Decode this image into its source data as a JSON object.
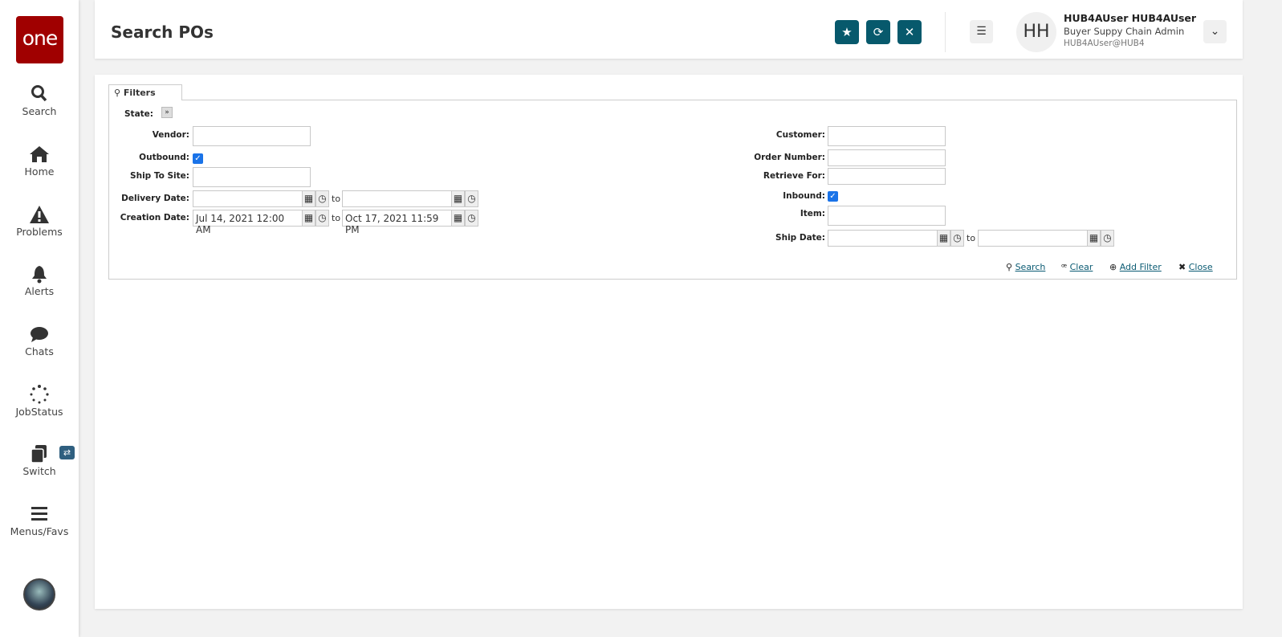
{
  "sidebar": {
    "logo": "one",
    "items": [
      {
        "label": "Search",
        "icon": "search-icon"
      },
      {
        "label": "Home",
        "icon": "home-icon"
      },
      {
        "label": "Problems",
        "icon": "warning-icon"
      },
      {
        "label": "Alerts",
        "icon": "bell-icon"
      },
      {
        "label": "Chats",
        "icon": "chat-icon"
      },
      {
        "label": "JobStatus",
        "icon": "spinner-icon"
      },
      {
        "label": "Switch",
        "icon": "switch-icon"
      },
      {
        "label": "Menus/Favs",
        "icon": "menu-icon"
      }
    ],
    "switch_badge": "⇄"
  },
  "header": {
    "title": "Search POs",
    "user": {
      "initials": "HH",
      "name": "HUB4AUser HUB4AUser",
      "role": "Buyer Suppy Chain Admin",
      "login": "HUB4AUser@HUB4"
    }
  },
  "filters": {
    "tab": "Filters",
    "left": {
      "state": "State:",
      "vendor": "Vendor:",
      "outbound": "Outbound:",
      "ship_to_site": "Ship To Site:",
      "delivery_date": "Delivery Date:",
      "creation_date": "Creation Date:",
      "creation_from": "Jul 14, 2021 12:00 AM",
      "creation_to": "Oct 17, 2021 11:59 PM"
    },
    "right": {
      "customer": "Customer:",
      "order_number": "Order Number:",
      "retrieve_for": "Retrieve For:",
      "inbound": "Inbound:",
      "item": "Item:",
      "ship_date": "Ship Date:"
    },
    "to": "to",
    "actions": {
      "search": "Search",
      "clear": "Clear",
      "add_filter": "Add Filter",
      "close": "Close"
    }
  }
}
